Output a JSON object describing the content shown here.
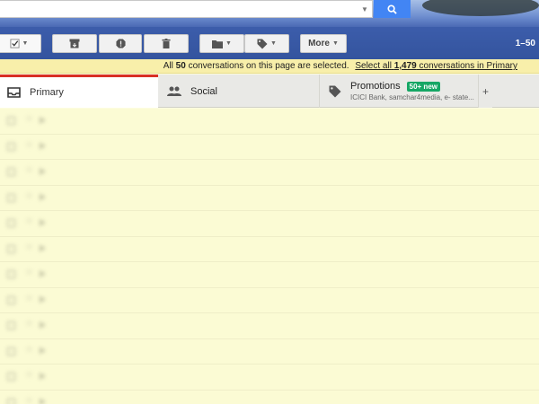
{
  "toolbar": {
    "select_icon": "checkbox-icon",
    "archive_icon": "archive-icon",
    "spam_icon": "report-spam-icon",
    "delete_icon": "trash-icon",
    "move_icon": "folder-icon",
    "labels_icon": "label-icon",
    "more_label": "More",
    "range_text": "1–50"
  },
  "search": {
    "button_icon": "search-icon",
    "placeholder": ""
  },
  "banner": {
    "prefix": "All",
    "count": "50",
    "middle": "conversations on this page are selected.",
    "link_prefix": "Select all",
    "link_count": "1,479",
    "link_suffix": "conversations in Primary"
  },
  "tabs": {
    "primary": {
      "label": "Primary",
      "icon": "inbox-icon"
    },
    "social": {
      "label": "Social",
      "icon": "people-icon"
    },
    "promotions": {
      "label": "Promotions",
      "icon": "tag-icon",
      "badge": "50+ new",
      "senders": "ICICI Bank, samchar4media, e- state..."
    },
    "add_icon": "plus-icon"
  },
  "colors": {
    "accent_blue": "#4285f4",
    "primary_tab_red": "#d93025",
    "badge_green": "#16a765",
    "selected_row": "#fbfbd4",
    "banner_bg": "#f8efaa"
  },
  "messages": [
    {
      "sender": "",
      "subject": "",
      "snippet": ""
    },
    {
      "sender": "",
      "subject": "",
      "snippet": ""
    },
    {
      "sender": "",
      "subject": "",
      "snippet": ""
    },
    {
      "sender": "",
      "subject": "",
      "snippet": ""
    },
    {
      "sender": "",
      "subject": "",
      "snippet": ""
    },
    {
      "sender": "",
      "subject": "",
      "snippet": ""
    },
    {
      "sender": "",
      "subject": "",
      "snippet": ""
    },
    {
      "sender": "",
      "subject": "",
      "snippet": ""
    },
    {
      "sender": "",
      "subject": "",
      "snippet": ""
    },
    {
      "sender": "",
      "subject": "",
      "snippet": ""
    },
    {
      "sender": "",
      "subject": "",
      "snippet": ""
    },
    {
      "sender": "",
      "subject": "",
      "snippet": ""
    }
  ]
}
